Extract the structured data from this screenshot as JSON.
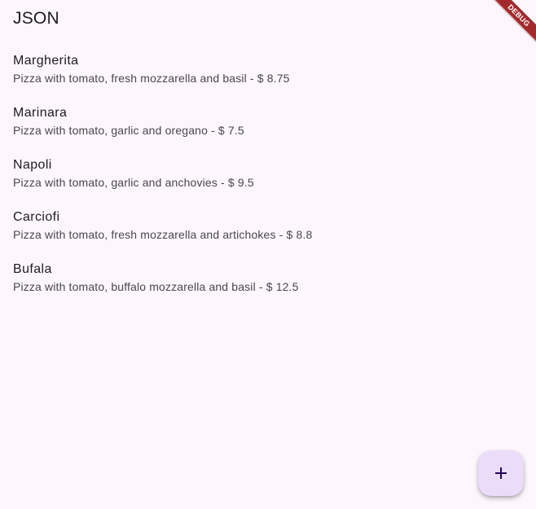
{
  "app_bar": {
    "title": "JSON"
  },
  "pizzas": [
    {
      "name": "Margherita",
      "description": "Pizza with tomato, fresh mozzarella and basil - $ 8.75"
    },
    {
      "name": "Marinara",
      "description": "Pizza with tomato, garlic and oregano - $ 7.5"
    },
    {
      "name": "Napoli",
      "description": "Pizza with tomato, garlic and anchovies - $ 9.5"
    },
    {
      "name": "Carciofi",
      "description": "Pizza with tomato, fresh mozzarella and artichokes - $ 8.8"
    },
    {
      "name": "Bufala",
      "description": "Pizza with tomato, buffalo mozzarella and basil - $ 12.5"
    }
  ],
  "debug_banner": {
    "label": "DEBUG",
    "color": "#a3292c"
  },
  "fab": {
    "icon": "add-icon",
    "background": "#ebdcf9"
  },
  "colors": {
    "background": "#fdf7fd",
    "text_primary": "#1d1b20",
    "text_secondary": "#49454f"
  }
}
